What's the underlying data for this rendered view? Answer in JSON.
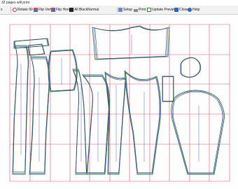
{
  "status": {
    "text": "32 pages will print"
  },
  "toolbar": {
    "items": [
      {
        "label": "x",
        "icon": "close-icon"
      },
      {
        "label": "Rotate 90",
        "icon": "rotate-icon"
      },
      {
        "label": "Flip Vert",
        "icon": "flip-vertical-icon"
      },
      {
        "label": "Flip Horz",
        "icon": "flip-horizontal-icon"
      },
      {
        "label": "All Black",
        "icon": "all-black-icon"
      },
      {
        "label": "Setup",
        "icon": "setup-icon"
      },
      {
        "label": "Print",
        "icon": "printer-icon"
      },
      {
        "label": "Update Preview",
        "icon": "update-preview-icon"
      },
      {
        "label": "Close",
        "icon": "close-window-icon"
      },
      {
        "label": "Help",
        "icon": "help-icon"
      }
    ],
    "line_style": {
      "value": "Normal"
    }
  },
  "colors": {
    "page_grid": "#d8566c",
    "pattern_outer": "#2f7d4a",
    "pattern_mid": "#4a68c8",
    "pattern_inner": "#333333",
    "toolbar_bg": "#f2f2f2"
  }
}
